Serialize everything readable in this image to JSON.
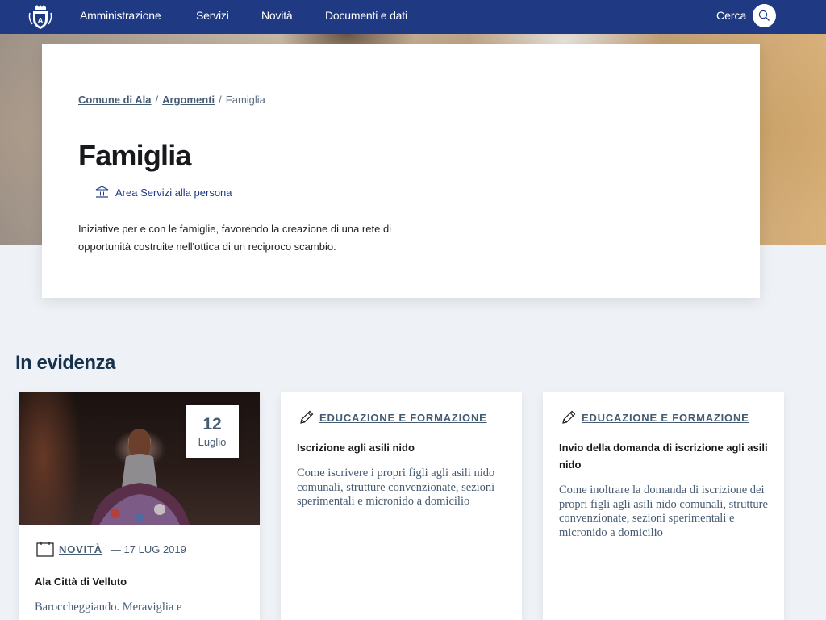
{
  "nav": {
    "items": [
      "Amministrazione",
      "Servizi",
      "Novità",
      "Documenti e dati"
    ],
    "search_label": "Cerca"
  },
  "breadcrumb": {
    "home": "Comune di Ala",
    "section": "Argomenti",
    "current": "Famiglia",
    "separator": "/"
  },
  "page": {
    "title": "Famiglia",
    "area_link": "Area Servizi alla persona",
    "description": "Iniziative per e con le famiglie, favorendo la creazione di una rete di opportunità costruite nell'ottica di un reciproco scambio."
  },
  "highlights": {
    "title": "In evidenza",
    "cards": [
      {
        "badge_day": "12",
        "badge_month": "Luglio",
        "category": "NOVITÀ",
        "date": "— 17 LUG 2019",
        "title": "Ala Città di Velluto",
        "text": "Baroccheggiando. Meraviglia e"
      },
      {
        "category": "EDUCAZIONE E FORMAZIONE",
        "title": "Iscrizione agli asili nido",
        "text": "Come iscrivere i propri figli agli asili nido comunali, strutture convenzionate, sezioni sperimentali e micronido a domicilio"
      },
      {
        "category": "EDUCAZIONE E FORMAZIONE",
        "title": "Invio della domanda di iscrizione agli asili nido",
        "text": "Come inoltrare la domanda di iscrizione dei propri figli agli asili nido comunali, strutture convenzionate, sezioni sperimentali e micronido a domicilio"
      }
    ]
  },
  "colors": {
    "nav_bg": "#1f3a83",
    "heading": "#17324d",
    "muted": "#455b71",
    "page_bg": "#eef2f7"
  },
  "icons": [
    "crest-logo",
    "search-icon",
    "institution-icon",
    "calendar-icon",
    "pencil-icon"
  ]
}
